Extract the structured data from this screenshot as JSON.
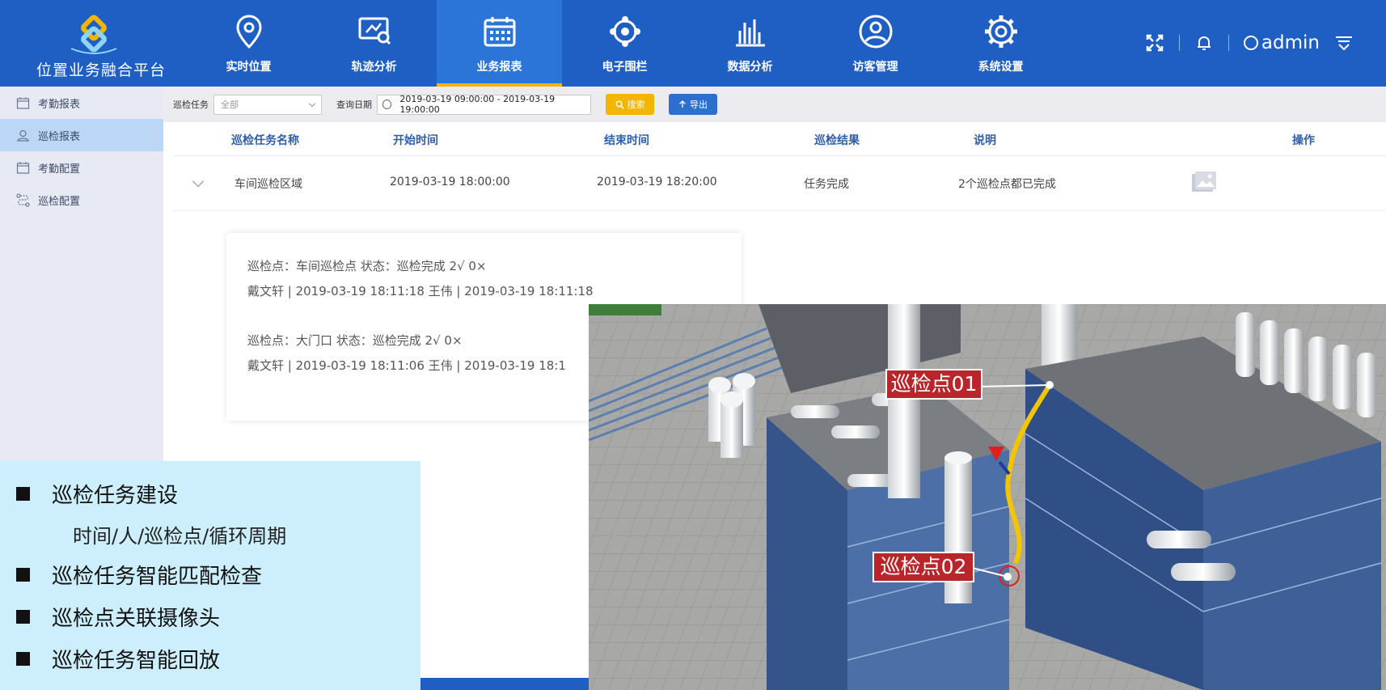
{
  "app": {
    "title": "位置业务融合平台"
  },
  "nav": {
    "items": [
      {
        "label": "实时位置",
        "icon": "location-pin-icon"
      },
      {
        "label": "轨迹分析",
        "icon": "track-monitor-icon"
      },
      {
        "label": "业务报表",
        "icon": "calendar-report-icon",
        "active": true
      },
      {
        "label": "电子围栏",
        "icon": "fence-icon"
      },
      {
        "label": "数据分析",
        "icon": "bar-chart-icon"
      },
      {
        "label": "访客管理",
        "icon": "visitor-user-icon"
      },
      {
        "label": "系统设置",
        "icon": "gear-icon"
      }
    ]
  },
  "header": {
    "user": "admin"
  },
  "sidebar": {
    "items": [
      {
        "label": "考勤报表",
        "icon": "calendar-icon"
      },
      {
        "label": "巡检报表",
        "icon": "location-person-icon",
        "active": true
      },
      {
        "label": "考勤配置",
        "icon": "calendar-icon"
      },
      {
        "label": "巡检配置",
        "icon": "route-icon"
      }
    ]
  },
  "filter": {
    "task_label": "巡检任务",
    "task_value": "全部",
    "date_label": "查询日期",
    "date_value": "2019-03-19 09:00:00  - 2019-03-19 19:00:00",
    "search_label": "搜索",
    "export_label": "导出"
  },
  "table": {
    "headers": [
      "巡检任务名称",
      "开始时间",
      "结束时间",
      "巡检结果",
      "说明",
      "操作"
    ],
    "rows": [
      {
        "name": "车间巡检区域",
        "start": "2019-03-19 18:00:00",
        "end": "2019-03-19 18:20:00",
        "result": "任务完成",
        "note": "2个巡检点都已完成"
      }
    ]
  },
  "detail": {
    "entries": [
      {
        "line1": "巡检点：车间巡检点 状态：巡检完成 2√ 0×",
        "line2": "戴文轩 | 2019-03-19 18:11:18 王伟 | 2019-03-19 18:11:18"
      },
      {
        "line1": "巡检点：大门口 状态：巡检完成 2√ 0×",
        "line2": "戴文轩 | 2019-03-19 18:11:06 王伟 | 2019-03-19 18:1"
      }
    ]
  },
  "features": {
    "items": [
      "巡检任务建设",
      "巡检任务智能匹配检查",
      "巡检点关联摄像头",
      "巡检任务智能回放"
    ],
    "sub": "时间/人/巡检点/循环周期"
  },
  "scene": {
    "point1": "巡检点01",
    "point2": "巡检点02"
  }
}
